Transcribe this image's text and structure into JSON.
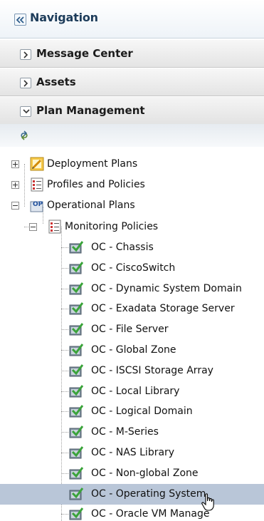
{
  "header": {
    "title": "Navigation"
  },
  "accordions": [
    {
      "label": "Message Center",
      "expanded": false
    },
    {
      "label": "Assets",
      "expanded": false
    },
    {
      "label": "Plan Management",
      "expanded": true
    }
  ],
  "tree": {
    "roots": [
      {
        "label": "Deployment Plans",
        "icon": "deployment-plans-icon"
      },
      {
        "label": "Profiles and Policies",
        "icon": "checklist-icon"
      },
      {
        "label": "Operational Plans",
        "icon": "op-icon"
      }
    ],
    "monitoring_policies": {
      "label": "Monitoring Policies",
      "icon": "checklist-icon"
    },
    "policy_items": [
      "OC - Chassis",
      "OC - CiscoSwitch",
      "OC - Dynamic System Domain",
      "OC - Exadata Storage Server",
      "OC - File Server",
      "OC - Global Zone",
      "OC - ISCSI Storage Array",
      "OC - Local Library",
      "OC - Logical Domain",
      "OC - M-Series",
      "OC - NAS Library",
      "OC - Non-global Zone",
      "OC - Operating System",
      "OC - Oracle VM Manage"
    ],
    "selected_item": "OC - Operating System"
  },
  "colors": {
    "selected_row": "#b9c6d8",
    "header_text": "#1d3c5a",
    "policy_icon_green": "#3aa33a"
  }
}
